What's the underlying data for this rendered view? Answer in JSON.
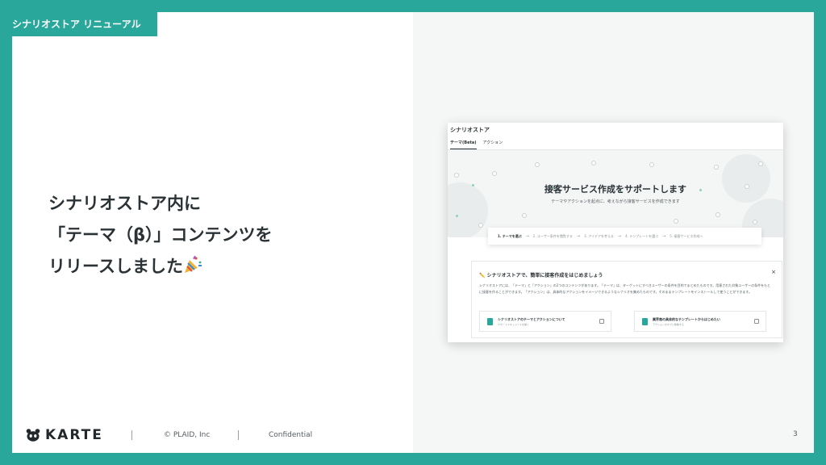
{
  "slide": {
    "section_label": "シナリオストア リニューアル",
    "heading_lines": [
      "シナリオストア内に",
      "「テーマ（β）」コンテンツを",
      "リリースしました"
    ],
    "footer": {
      "brand": "KARTE",
      "copyright": "© PLAID, Inc",
      "confidential": "Confidential",
      "page": "3"
    },
    "colors": {
      "accent": "#2aa79b",
      "panel": "#f5f6f6"
    }
  },
  "app": {
    "title": "シナリオストア",
    "tabs": [
      {
        "label": "テーマ(Beta)",
        "active": true
      },
      {
        "label": "アクション",
        "active": false
      }
    ],
    "hero": {
      "title": "接客サービス作成をサポートします",
      "subtitle": "テーマやアクションを起点に、考えながら接客サービスを作成できます"
    },
    "steps": [
      "1. テーマを選ぶ",
      "2. ユーザー条件を閲覧する",
      "3. アイデアを考える",
      "4. テンプレートを選ぶ",
      "5. 接客サービス作成へ"
    ],
    "info": {
      "title": "シナリオストアで、簡単に接客作成をはじめましょう",
      "body": "シナリオストアには、「テーマ」と「アクション」の2つのコンテンツがあります。「テーマ」は、ターゲットにすべきユーザーの条件を目的でまとめたものです。用意された対象ユーザーの条件をもとに接客を作ることができます。「アクション」は、具体的なアクションをイメージできるようなシナリオを集めたものです。そのままテンプレートをインストールして使うことができます。",
      "close": "×",
      "cards": [
        {
          "title": "シナリオストアのテーマとアクションについて",
          "sub": "サポートドキュメントを開く"
        },
        {
          "title": "業界毎の具体的なテンプレートからはじめたい",
          "sub": "アクションのタブに移動する"
        }
      ]
    }
  }
}
